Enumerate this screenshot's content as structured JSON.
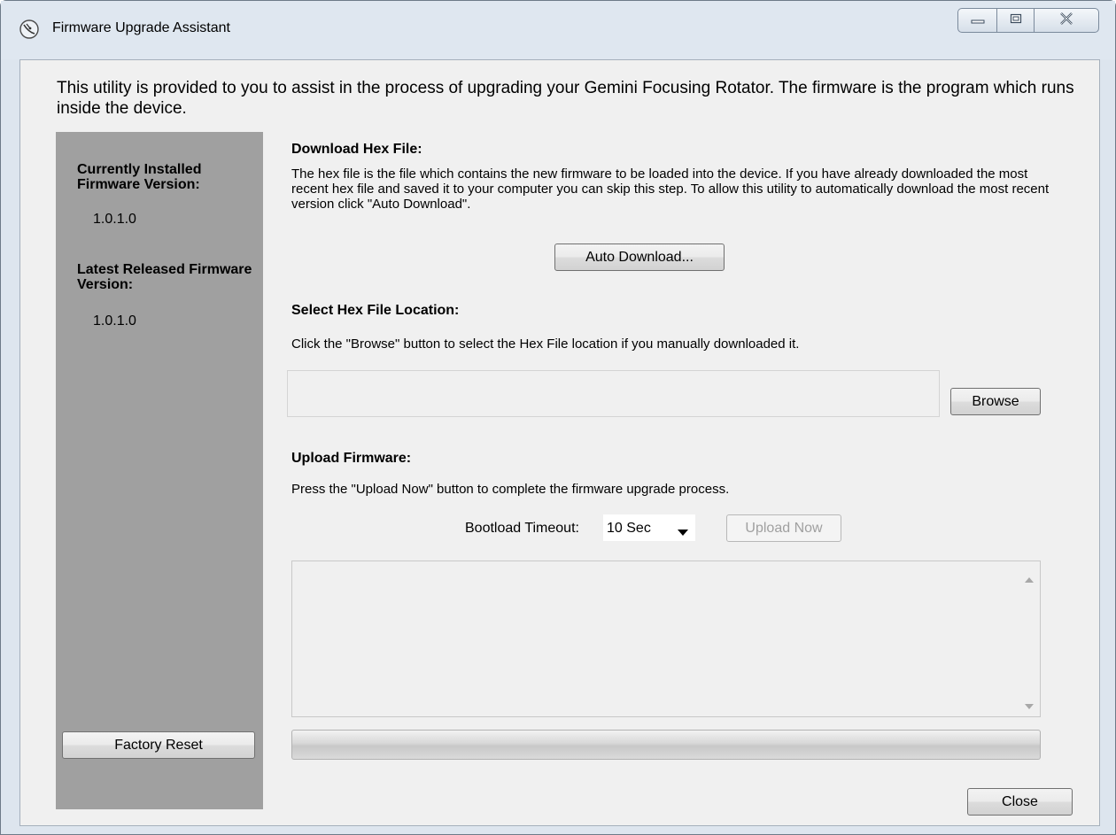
{
  "window": {
    "title": "Firmware Upgrade Assistant",
    "app_icon": "satellite-dish-icon"
  },
  "caption_buttons": {
    "minimize_icon": "minimize-icon",
    "maximize_icon": "maximize-icon",
    "close_icon": "close-icon"
  },
  "intro": "This utility is provided to you to assist in the process of upgrading your Gemini Focusing Rotator. The firmware is the program which runs inside the device.",
  "sidebar": {
    "installed_label": "Currently Installed Firmware Version:",
    "installed_version": "1.0.1.0",
    "latest_label": "Latest Released Firmware Version:",
    "latest_version": "1.0.1.0",
    "factory_reset": "Factory Reset"
  },
  "download": {
    "title": "Download Hex File:",
    "description": "The hex file is the file which contains the new firmware to be loaded into the device. If you have already downloaded the most recent hex file and saved it to your computer you can skip this step. To allow this utility to automatically download the most recent version click \"Auto Download\".",
    "button": "Auto Download..."
  },
  "select_hex": {
    "title": "Select Hex File Location:",
    "description": "Click the \"Browse\" button to select the Hex File location if you manually downloaded it.",
    "path_value": "",
    "browse": "Browse"
  },
  "upload": {
    "title": "Upload Firmware:",
    "description": "Press the \"Upload Now\" button to complete the firmware upgrade process.",
    "timeout_label": "Bootload Timeout:",
    "timeout_value": "10 Sec",
    "upload_button": "Upload Now",
    "upload_enabled": false,
    "log_text": "",
    "progress": 0
  },
  "footer": {
    "close": "Close"
  },
  "colors": {
    "sidebar": "#a0a0a0",
    "client": "#f0f0f0",
    "frame": "#dde5ee"
  }
}
